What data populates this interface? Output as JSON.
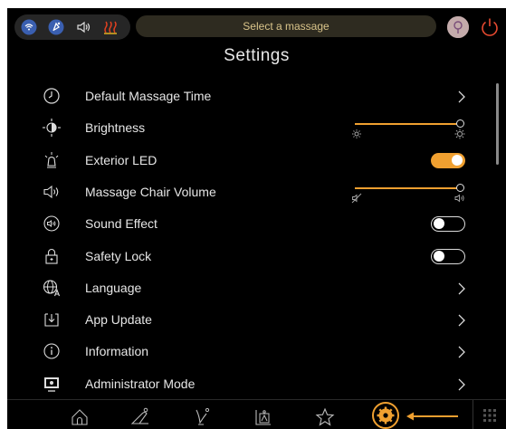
{
  "header": {
    "select_prompt": "Select a massage",
    "status_icons": [
      "wifi-icon",
      "bluetooth-body-icon",
      "volume-icon",
      "heat-icon"
    ],
    "profile_icon": "user-avatar-icon",
    "power_icon": "power-icon"
  },
  "page": {
    "title": "Settings"
  },
  "settings": [
    {
      "label": "Default Massage Time",
      "icon": "clock-icon",
      "control": "chevron"
    },
    {
      "label": "Brightness",
      "icon": "brightness-icon",
      "control": "slider",
      "value": 1.0
    },
    {
      "label": "Exterior LED",
      "icon": "lamp-icon",
      "control": "toggle",
      "state": "on"
    },
    {
      "label": "Massage Chair Volume",
      "icon": "speaker-icon",
      "control": "slider",
      "value": 1.0
    },
    {
      "label": "Sound Effect",
      "icon": "sound-effect-icon",
      "control": "toggle",
      "state": "off"
    },
    {
      "label": "Safety Lock",
      "icon": "padlock-icon",
      "control": "toggle",
      "state": "off"
    },
    {
      "label": "Language",
      "icon": "globe-language-icon",
      "control": "chevron"
    },
    {
      "label": "App Update",
      "icon": "download-icon",
      "control": "chevron"
    },
    {
      "label": "Information",
      "icon": "info-icon",
      "control": "chevron"
    },
    {
      "label": "Administrator Mode",
      "icon": "monitor-icon",
      "control": "chevron"
    }
  ],
  "bottom_nav": {
    "items": [
      "home-icon",
      "massage-chair-icon",
      "body-stretch-icon",
      "program-icon",
      "favorites-icon",
      "settings-gear-icon"
    ],
    "active": "settings-gear-icon",
    "extra": "grid-menu-icon"
  },
  "colors": {
    "accent": "#f0a030",
    "background": "#000000",
    "text": "#e6e6e6",
    "select_text": "#d9c48a"
  }
}
